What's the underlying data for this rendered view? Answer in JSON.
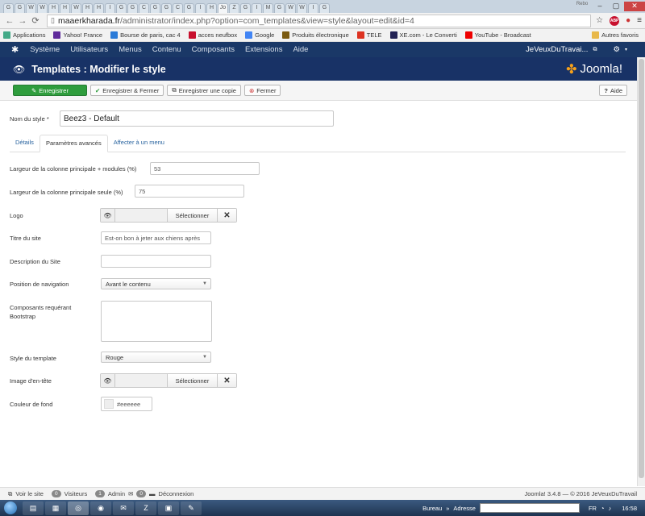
{
  "browser": {
    "tabs": [
      "G",
      "G",
      "W",
      "W",
      "H",
      "H",
      "W",
      "H",
      "H",
      "I",
      "G",
      "G",
      "C",
      "G",
      "G",
      "C",
      "G",
      "I",
      "H",
      "Jo",
      "Z",
      "G",
      "I",
      "M",
      "G",
      "W",
      "W",
      "I",
      "G"
    ],
    "window_controls": {
      "title": "Rebo"
    },
    "url_host": "maaerkharada.fr",
    "url_path": "/administrator/index.php?option=com_templates&view=style&layout=edit&id=4",
    "bookmarks": [
      {
        "label": "Applications",
        "icon": "apps-icon",
        "color": "#4a8"
      },
      {
        "label": "Yahoo! France",
        "icon": "yahoo-icon",
        "color": "#5f2b9b"
      },
      {
        "label": "Bourse de paris, cac 4",
        "icon": "chart-icon",
        "color": "#2b7bd8"
      },
      {
        "label": "acces neufbox",
        "icon": "sfr-icon",
        "color": "#c8102e"
      },
      {
        "label": "Google",
        "icon": "google-icon",
        "color": "#4285f4"
      },
      {
        "label": "Produits électronique",
        "icon": "shop-icon",
        "color": "#7a5a10"
      },
      {
        "label": "TELE",
        "icon": "tele-icon",
        "color": "#d32"
      },
      {
        "label": "XE.com - Le Converti",
        "icon": "xe-icon",
        "color": "#225"
      },
      {
        "label": "YouTube - Broadcast",
        "icon": "youtube-icon",
        "color": "#e00"
      }
    ],
    "bookmarks_right": "Autres favoris"
  },
  "joomla": {
    "menu": [
      "Système",
      "Utilisateurs",
      "Menus",
      "Contenu",
      "Composants",
      "Extensions",
      "Aide"
    ],
    "site_name": "JeVeuxDuTravai...",
    "page_title": "Templates : Modifier le style",
    "brand": "Joomla!",
    "toolbar": {
      "save": "Enregistrer",
      "save_close": "Enregistrer & Fermer",
      "save_copy": "Enregistrer une copie",
      "close": "Fermer",
      "help": "Aide"
    },
    "form": {
      "style_name_label": "Nom du style *",
      "style_name_value": "Beez3 - Default",
      "tabs": [
        "Détails",
        "Paramètres avancés",
        "Affecter à un menu"
      ],
      "width_modules_label": "Largeur de la colonne principale + modules (%)",
      "width_modules_value": "53",
      "width_alone_label": "Largeur de la colonne principale seule (%)",
      "width_alone_value": "75",
      "logo_label": "Logo",
      "select_label": "Sélectionner",
      "site_title_label": "Titre du site",
      "site_title_value": "Est-on bon à jeter aux chiens après",
      "site_desc_label": "Description du Site",
      "site_desc_value": "",
      "nav_pos_label": "Position de navigation",
      "nav_pos_value": "Avant le contenu",
      "bootstrap_label_1": "Composants requérant",
      "bootstrap_label_2": "Bootstrap",
      "template_style_label": "Style du template",
      "template_style_value": "Rouge",
      "header_image_label": "Image d'en-tête",
      "bg_color_label": "Couleur de fond",
      "bg_color_value": "#eeeeee"
    },
    "status": {
      "view_site": "Voir le site",
      "visitors_count": "0",
      "visitors_label": "Visiteurs",
      "admin_count": "1",
      "admin_label": "Admin",
      "msg_count": "0",
      "logout": "Déconnexion",
      "version": "Joomla! 3.4.8  —  © 2016 JeVeuxDuTravail"
    }
  },
  "taskbar": {
    "bureau": "Bureau",
    "adresse": "Adresse",
    "lang": "FR",
    "time": "16:58"
  },
  "colors": {
    "nav_bg": "#1a3867",
    "save_green": "#2f9d3d",
    "link_blue": "#2b65a0"
  }
}
